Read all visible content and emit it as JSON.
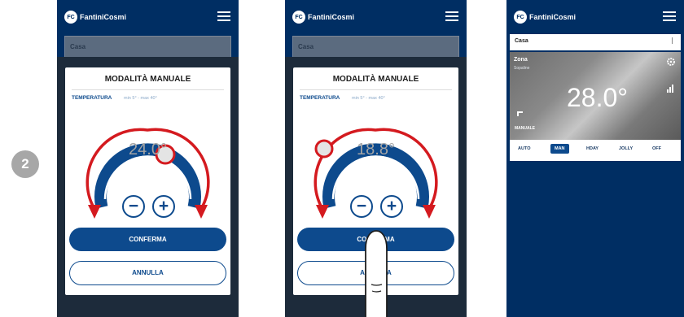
{
  "step_number": "2",
  "app": {
    "brand": "FantiniCosmi",
    "logo_mark": "FC",
    "location": "Casa"
  },
  "screen1": {
    "modal_title": "MODALITÀ MANUALE",
    "temperature_label": "TEMPERATURA",
    "temperature_range": "min 5° - max 40°",
    "setpoint": "24.0°",
    "decrease_label": "−",
    "increase_label": "+",
    "confirm_label": "CONFERMA",
    "cancel_label": "ANNULLA"
  },
  "screen2": {
    "modal_title": "MODALITÀ MANUALE",
    "temperature_label": "TEMPERATURA",
    "temperature_range": "min 5° - max 40°",
    "setpoint": "18.8°",
    "decrease_label": "−",
    "increase_label": "+",
    "confirm_label": "CONFERMA",
    "cancel_label": "ANNULLA"
  },
  "screen3": {
    "zone_name": "Zona",
    "zone_subtitle": "Sopaline",
    "zone_temperature": "28.0°",
    "zone_mode": "MANUALE",
    "modes": [
      "AUTO",
      "MAN",
      "HDAY",
      "JOLLY",
      "OFF"
    ],
    "active_mode": "MAN"
  },
  "colors": {
    "primary": "#0d4a8d",
    "app_background": "#002e63",
    "arrow_red": "#d41a1f",
    "step_badge": "#a7a7a7"
  },
  "icons": [
    "menu-icon",
    "minus-icon",
    "plus-icon",
    "gear-icon",
    "signal-icon",
    "tap-icon",
    "finger-pointer-icon"
  ]
}
